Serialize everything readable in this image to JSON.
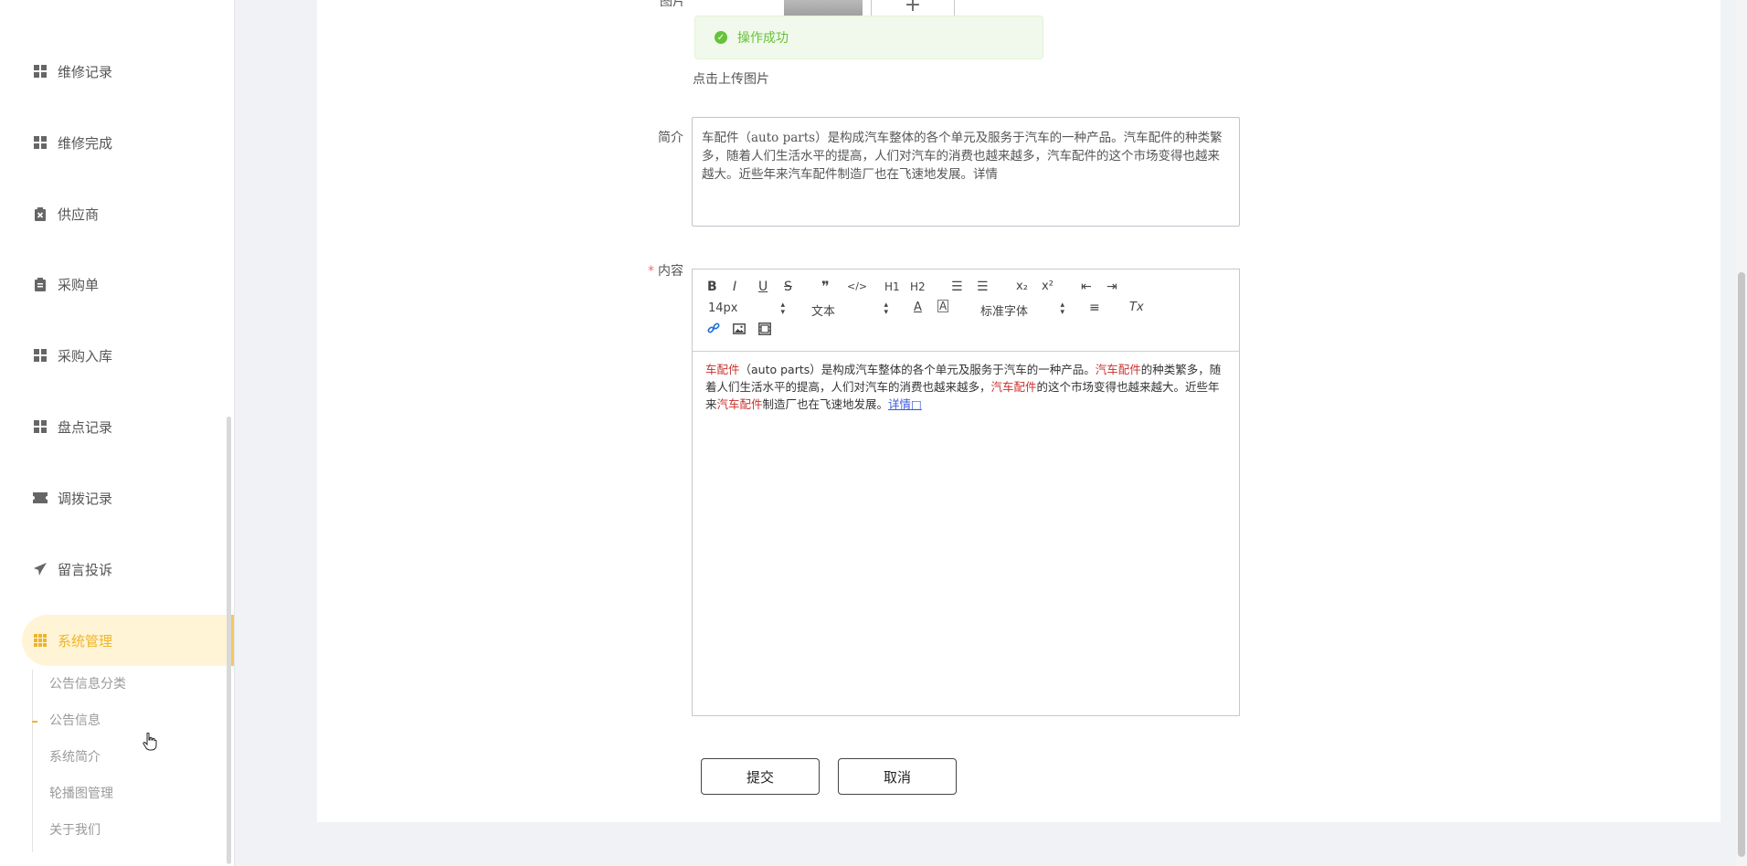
{
  "sidebar": {
    "items": [
      {
        "label": "维修记录",
        "icon": "grid-icon"
      },
      {
        "label": "维修完成",
        "icon": "grid-icon"
      },
      {
        "label": "供应商",
        "icon": "clipboard-x-icon"
      },
      {
        "label": "采购单",
        "icon": "clipboard-icon"
      },
      {
        "label": "采购入库",
        "icon": "grid-icon"
      },
      {
        "label": "盘点记录",
        "icon": "grid-icon"
      },
      {
        "label": "调拨记录",
        "icon": "ticket-icon"
      },
      {
        "label": "留言投诉",
        "icon": "paper-plane-icon"
      },
      {
        "label": "系统管理",
        "icon": "apps-icon",
        "active": true
      }
    ],
    "submenu": [
      "公告信息分类",
      "公告信息",
      "系统简介",
      "轮播图管理",
      "关于我们"
    ],
    "accent_color": "#f0b429"
  },
  "form": {
    "image_label": "图片",
    "upload_hint": "点击上传图片",
    "summary_label": "简介",
    "summary_value": "车配件（auto parts）是构成汽车整体的各个单元及服务于汽车的一种产品。汽车配件的种类繁多，随着人们生活水平的提高，人们对汽车的消费也越来越多，汽车配件的这个市场变得也越来越大。近些年来汽车配件制造厂也在飞速地发展。详情",
    "content_label": "内容",
    "required_mark": "*"
  },
  "toast": {
    "message": "操作成功",
    "status_color": "#67c23a"
  },
  "editor": {
    "toolbar": {
      "bold": "B",
      "italic": "I",
      "underline": "U",
      "strike": "S",
      "quote": "❞",
      "code": "</>",
      "h1": "H1",
      "h2": "H2",
      "ordered_list": "☰",
      "bullet_list": "☰",
      "subscript": "x₂",
      "superscript": "x²",
      "outdent": "⇤",
      "indent": "⇥",
      "size": "14px",
      "header": "文本",
      "font": "标准字体",
      "color": "A",
      "background": "A",
      "align": "≡",
      "clean": "Tx"
    },
    "content": {
      "seg1": "车配件",
      "seg2": "（auto parts）是构成汽车整体的各个单元及服务于汽车的一种产品。",
      "seg3": "汽车配件",
      "seg4": "的种类繁多，随着人们生活水平的提高，人们对汽车的消费也越来越多，",
      "seg5": "汽车配件",
      "seg6": "的这个市场变得也越来越大。近些年来",
      "seg7": "汽车配件",
      "seg8": "制造厂也在飞速地发展。",
      "link": "详情□"
    }
  },
  "buttons": {
    "submit": "提交",
    "cancel": "取消"
  }
}
